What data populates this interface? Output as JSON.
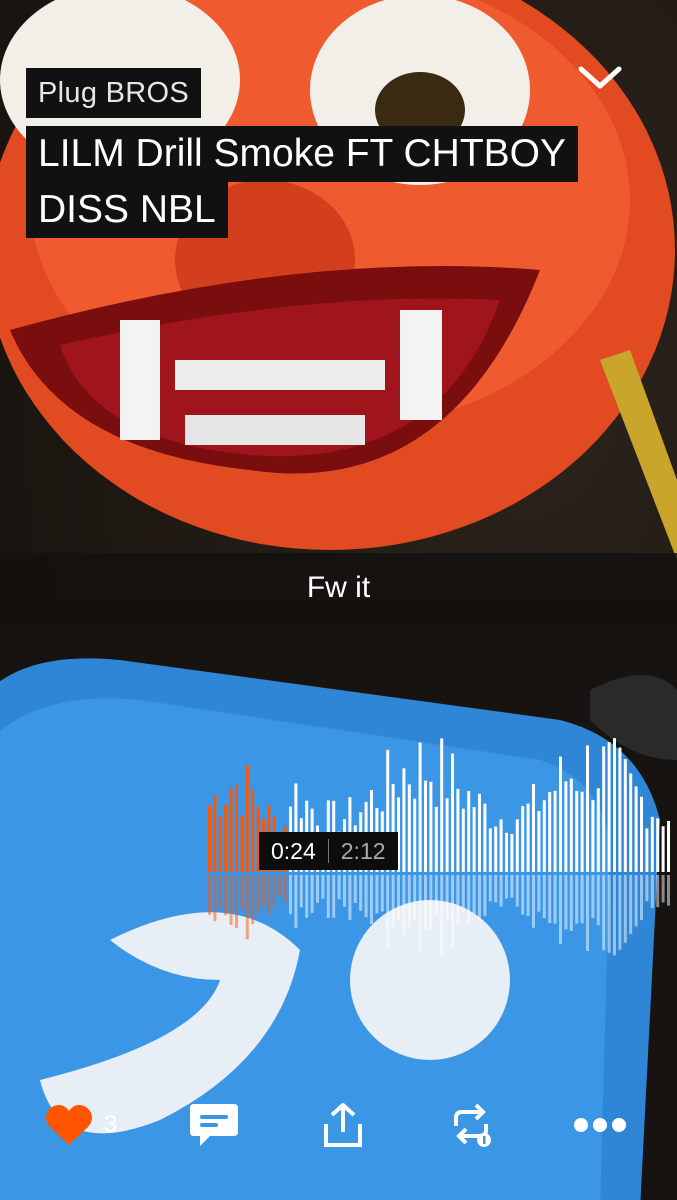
{
  "header": {
    "artist": "Plug BROS",
    "title_line1": "LILM Drill Smoke FT CHTBOY",
    "title_line2": "DISS NBL"
  },
  "comment": {
    "text": "Fw it"
  },
  "player": {
    "current_time": "0:24",
    "total_time": "2:12",
    "progress": 0.18,
    "played_color": "#ff5500",
    "unplayed_color": "#ffffff"
  },
  "actions": {
    "like_count": "3",
    "like_color": "#ff5500",
    "icons": [
      "heart-icon",
      "comment-icon",
      "share-icon",
      "repost-icon",
      "more-icon"
    ]
  }
}
